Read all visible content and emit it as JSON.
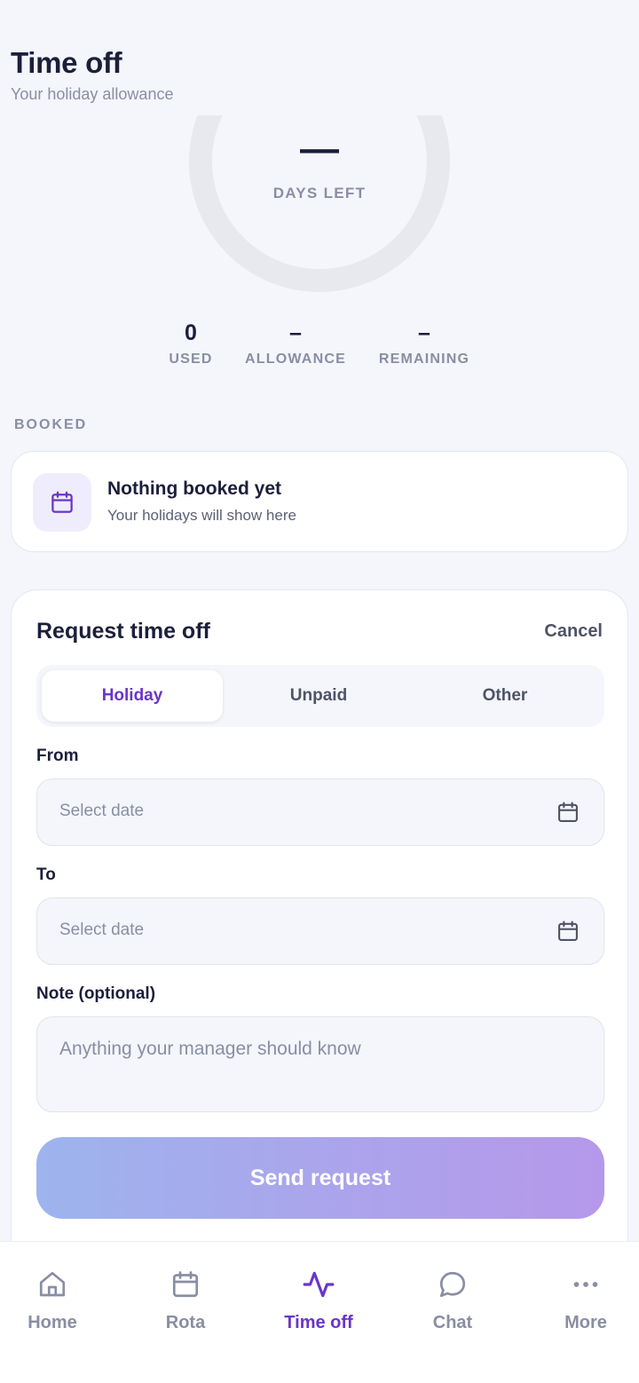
{
  "header": {
    "title": "Time off",
    "subtitle": "Your holiday allowance"
  },
  "ring": {
    "value": "—",
    "label": "DAYS LEFT",
    "progress": 0,
    "track_color": "#e7e9ef"
  },
  "stats": [
    {
      "value": "0",
      "label": "USED"
    },
    {
      "value": "–",
      "label": "ALLOWANCE"
    },
    {
      "value": "–",
      "label": "REMAINING"
    }
  ],
  "booked": {
    "section_label": "BOOKED",
    "icon": "calendar-icon",
    "empty_title": "Nothing booked yet",
    "empty_subtitle": "Your holidays will show here"
  },
  "request": {
    "title": "Request time off",
    "cancel_label": "Cancel",
    "types": [
      {
        "label": "Holiday",
        "active": true
      },
      {
        "label": "Unpaid",
        "active": false
      },
      {
        "label": "Other",
        "active": false
      }
    ],
    "from": {
      "label": "From",
      "value": "",
      "placeholder": "Select date"
    },
    "to": {
      "label": "To",
      "value": "",
      "placeholder": "Select date"
    },
    "note": {
      "label": "Note (optional)",
      "value": "",
      "placeholder": "Anything your manager should know"
    },
    "submit_label": "Send request"
  },
  "tabbar": {
    "active": "Time off",
    "items": [
      {
        "label": "Home",
        "icon": "home-icon"
      },
      {
        "label": "Rota",
        "icon": "calendar-icon"
      },
      {
        "label": "Time off",
        "icon": "pulse-icon"
      },
      {
        "label": "Chat",
        "icon": "chat-bubble-icon"
      },
      {
        "label": "More",
        "icon": "more-dots-icon"
      }
    ]
  },
  "colors": {
    "accent": "#6a35c8",
    "text_primary": "#1c1f3a",
    "text_muted": "#8a8ea3",
    "background": "#f4f6fb",
    "button_gradient_start": "#9db4ee",
    "button_gradient_end": "#b698ea"
  }
}
